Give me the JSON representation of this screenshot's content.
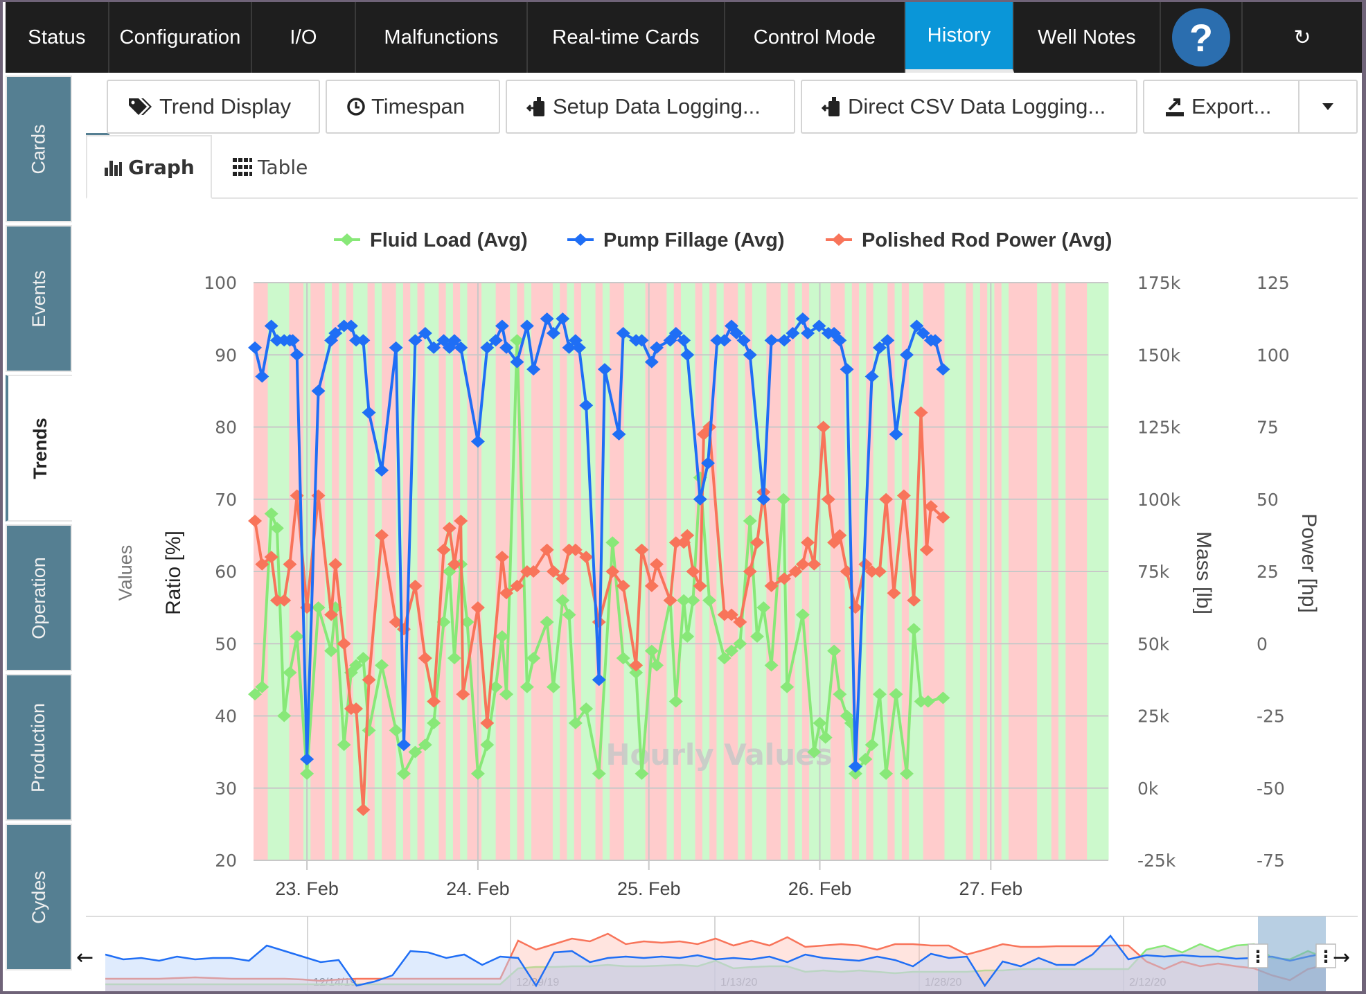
{
  "topnav": {
    "tabs": [
      {
        "label": "Status",
        "active": false
      },
      {
        "label": "Configuration",
        "active": false
      },
      {
        "label": "I/O",
        "active": false
      },
      {
        "label": "Malfunctions",
        "active": false
      },
      {
        "label": "Real-time Cards",
        "active": false
      },
      {
        "label": "Control Mode",
        "active": false
      },
      {
        "label": "History",
        "active": true
      },
      {
        "label": "Well Notes",
        "active": false
      }
    ],
    "help_label": "?",
    "refresh_label": "↻"
  },
  "sidetabs": [
    {
      "label": "Cards",
      "active": false
    },
    {
      "label": "Events",
      "active": false
    },
    {
      "label": "Trends",
      "active": true
    },
    {
      "label": "Operation",
      "active": false
    },
    {
      "label": "Production",
      "active": false
    },
    {
      "label": "Cydes",
      "active": false
    }
  ],
  "toolbar": {
    "trend_display": "Trend Display",
    "timespan": "Timespan",
    "setup_logging": "Setup Data Logging...",
    "direct_csv": "Direct CSV Data Logging...",
    "export": "Export...",
    "dropdown_icon": "caret-down-icon"
  },
  "view_tabs": {
    "graph": "Graph",
    "table": "Table",
    "active": "graph"
  },
  "colors": {
    "fluid_load": "#88e878",
    "pump_fillage": "#1f6ef5",
    "polished_rod_power": "#f8745a",
    "band_on": "#ccf9cc",
    "band_off": "#ffcccc",
    "active_tab": "#0a96d8",
    "side_tab": "#557f92"
  },
  "chart_data": {
    "type": "line",
    "watermark": "Hourly Values",
    "axis_title_group": "Values",
    "x_unit": "hours since 23 Feb 00:00",
    "xlim": [
      -7.5,
      112.5
    ],
    "x_ticks": [
      {
        "x": 0,
        "label": "23. Feb"
      },
      {
        "x": 24,
        "label": "24. Feb"
      },
      {
        "x": 48,
        "label": "25. Feb"
      },
      {
        "x": 72,
        "label": "26. Feb"
      },
      {
        "x": 96,
        "label": "27. Feb"
      }
    ],
    "y_axes": [
      {
        "title": "Ratio [%]",
        "side": "left",
        "ticks": [
          "100",
          "90",
          "80",
          "70",
          "60",
          "50",
          "40",
          "30",
          "20"
        ],
        "range": [
          20,
          100
        ]
      },
      {
        "title": "Mass [lb]",
        "side": "right",
        "ticks": [
          "175k",
          "150k",
          "125k",
          "100k",
          "75k",
          "50k",
          "25k",
          "0k",
          "-25k"
        ],
        "range": [
          -25000,
          175000
        ]
      },
      {
        "title": "Power [hp]",
        "side": "right",
        "ticks": [
          "125",
          "100",
          "75",
          "50",
          "25",
          "0",
          "-25",
          "-50",
          "-75"
        ],
        "range": [
          -75,
          125
        ]
      }
    ],
    "legend": [
      "Fluid Load (Avg)",
      "Pump Fillage (Avg)",
      "Polished Rod Power (Avg)"
    ],
    "legend_position": "top-center",
    "grid": true,
    "series": [
      {
        "name": "Pump Fillage (Avg)",
        "points": [
          [
            -7.3,
            91
          ],
          [
            -6.3,
            87
          ],
          [
            -5.0,
            94
          ],
          [
            -4.2,
            92
          ],
          [
            -3.2,
            92
          ],
          [
            -2.4,
            92
          ],
          [
            -2.0,
            92
          ],
          [
            -1.4,
            90
          ],
          [
            0,
            34
          ],
          [
            1.6,
            85
          ],
          [
            3.4,
            92
          ],
          [
            4.0,
            93
          ],
          [
            5.2,
            94
          ],
          [
            6.2,
            94
          ],
          [
            6.9,
            92
          ],
          [
            7.9,
            92
          ],
          [
            8.7,
            82
          ],
          [
            10.5,
            74
          ],
          [
            12.5,
            91
          ],
          [
            13.6,
            36
          ],
          [
            15.2,
            92
          ],
          [
            16.6,
            93
          ],
          [
            17.8,
            91
          ],
          [
            19.2,
            92
          ],
          [
            20.0,
            91
          ],
          [
            20.7,
            92
          ],
          [
            21.6,
            91
          ],
          [
            24.0,
            78
          ],
          [
            25.3,
            91
          ],
          [
            26.5,
            92
          ],
          [
            27.4,
            94
          ],
          [
            28.0,
            91
          ],
          [
            29.5,
            89
          ],
          [
            30.9,
            94
          ],
          [
            31.8,
            88
          ],
          [
            33.7,
            95
          ],
          [
            34.6,
            93
          ],
          [
            35.9,
            95
          ],
          [
            36.8,
            91
          ],
          [
            37.7,
            92
          ],
          [
            38.2,
            91
          ],
          [
            39.2,
            83
          ],
          [
            41.0,
            45
          ],
          [
            41.8,
            88
          ],
          [
            43.8,
            79
          ],
          [
            44.4,
            93
          ],
          [
            46.2,
            92
          ],
          [
            47.0,
            92
          ],
          [
            48.4,
            89
          ],
          [
            49.1,
            91
          ],
          [
            51.0,
            92
          ],
          [
            51.8,
            93
          ],
          [
            52.9,
            92
          ],
          [
            53.4,
            90
          ],
          [
            55.2,
            70
          ],
          [
            56.3,
            75
          ],
          [
            57.6,
            92
          ],
          [
            58.6,
            92
          ],
          [
            59.6,
            94
          ],
          [
            60.3,
            93
          ],
          [
            61.3,
            92
          ],
          [
            62.2,
            90
          ],
          [
            64.1,
            70
          ],
          [
            65.2,
            92
          ],
          [
            67.0,
            92
          ],
          [
            68.2,
            93
          ],
          [
            69.6,
            95
          ],
          [
            70.3,
            93
          ],
          [
            71.9,
            94
          ],
          [
            73.2,
            93
          ],
          [
            74.0,
            93
          ],
          [
            74.8,
            92
          ],
          [
            75.8,
            88
          ],
          [
            77.0,
            33
          ],
          [
            79.3,
            87
          ],
          [
            80.4,
            91
          ],
          [
            81.5,
            92
          ],
          [
            82.7,
            79
          ],
          [
            84.2,
            90
          ],
          [
            85.6,
            94
          ],
          [
            86.5,
            93
          ],
          [
            87.6,
            92
          ],
          [
            88.2,
            92
          ],
          [
            89.3,
            88
          ]
        ]
      },
      {
        "name": "Polished Rod Power (Avg)",
        "points": [
          [
            -7.3,
            67
          ],
          [
            -6.3,
            61
          ],
          [
            -5.0,
            62
          ],
          [
            -4.2,
            56
          ],
          [
            -3.2,
            56
          ],
          [
            -2.4,
            61
          ],
          [
            -1.4,
            70.5
          ],
          [
            0,
            55
          ],
          [
            1.6,
            70.5
          ],
          [
            3.4,
            54
          ],
          [
            4.0,
            61
          ],
          [
            5.2,
            50
          ],
          [
            6.2,
            41
          ],
          [
            6.9,
            41
          ],
          [
            7.9,
            27
          ],
          [
            8.7,
            45
          ],
          [
            10.5,
            65
          ],
          [
            12.5,
            53
          ],
          [
            13.6,
            52
          ],
          [
            15.2,
            58
          ],
          [
            16.6,
            48
          ],
          [
            17.8,
            42
          ],
          [
            19.2,
            63
          ],
          [
            20.0,
            66
          ],
          [
            20.7,
            61
          ],
          [
            21.6,
            67
          ],
          [
            21.9,
            43
          ],
          [
            24.0,
            55
          ],
          [
            25.3,
            39
          ],
          [
            27.4,
            62
          ],
          [
            28.0,
            57
          ],
          [
            29.5,
            58
          ],
          [
            30.9,
            60
          ],
          [
            31.8,
            60
          ],
          [
            33.7,
            63
          ],
          [
            34.6,
            60
          ],
          [
            35.9,
            59
          ],
          [
            36.8,
            63
          ],
          [
            37.7,
            63
          ],
          [
            39.2,
            62
          ],
          [
            41.0,
            53
          ],
          [
            42.9,
            60
          ],
          [
            44.4,
            58
          ],
          [
            46.2,
            47
          ],
          [
            47.0,
            63
          ],
          [
            48.4,
            58
          ],
          [
            49.1,
            61
          ],
          [
            51.0,
            56
          ],
          [
            51.8,
            64
          ],
          [
            52.9,
            64
          ],
          [
            53.4,
            65
          ],
          [
            54.2,
            60
          ],
          [
            55.2,
            58
          ],
          [
            55.7,
            79
          ],
          [
            56.5,
            80
          ],
          [
            58.6,
            54
          ],
          [
            59.6,
            54
          ],
          [
            60.8,
            53
          ],
          [
            62.2,
            60
          ],
          [
            63.2,
            64
          ],
          [
            64.1,
            71
          ],
          [
            65.2,
            58
          ],
          [
            67.0,
            59
          ],
          [
            68.6,
            60
          ],
          [
            69.6,
            61
          ],
          [
            70.3,
            64
          ],
          [
            71.2,
            61
          ],
          [
            72.5,
            80
          ],
          [
            73.2,
            70
          ],
          [
            74.0,
            64
          ],
          [
            74.8,
            65
          ],
          [
            75.8,
            60
          ],
          [
            77.0,
            55
          ],
          [
            78.4,
            61
          ],
          [
            79.3,
            60
          ],
          [
            80.4,
            60
          ],
          [
            81.3,
            70
          ],
          [
            82.4,
            57
          ],
          [
            83.8,
            70.5
          ],
          [
            85.2,
            56
          ],
          [
            86.2,
            82
          ],
          [
            87.0,
            63
          ],
          [
            87.6,
            69
          ],
          [
            89.3,
            67.5
          ]
        ]
      },
      {
        "name": "Fluid Load (Avg)",
        "points": [
          [
            -7.3,
            43
          ],
          [
            -6.3,
            44
          ],
          [
            -5.0,
            68
          ],
          [
            -4.2,
            66
          ],
          [
            -3.2,
            40
          ],
          [
            -2.4,
            46
          ],
          [
            -1.4,
            51
          ],
          [
            0,
            32
          ],
          [
            1.6,
            55
          ],
          [
            3.4,
            49
          ],
          [
            4.0,
            55
          ],
          [
            5.2,
            36
          ],
          [
            6.2,
            46
          ],
          [
            6.9,
            47
          ],
          [
            7.9,
            48
          ],
          [
            8.7,
            38
          ],
          [
            10.5,
            47
          ],
          [
            12.5,
            38
          ],
          [
            13.6,
            32
          ],
          [
            15.2,
            35
          ],
          [
            16.6,
            36
          ],
          [
            17.8,
            39
          ],
          [
            19.2,
            53
          ],
          [
            20.0,
            60
          ],
          [
            20.7,
            48
          ],
          [
            21.6,
            61
          ],
          [
            22.5,
            53
          ],
          [
            24.0,
            32
          ],
          [
            25.3,
            36
          ],
          [
            26.5,
            44
          ],
          [
            27.4,
            51
          ],
          [
            28.0,
            43
          ],
          [
            29.5,
            92
          ],
          [
            30.9,
            44
          ],
          [
            31.8,
            48
          ],
          [
            33.7,
            53
          ],
          [
            34.6,
            44
          ],
          [
            35.9,
            56
          ],
          [
            36.8,
            54
          ],
          [
            37.7,
            39
          ],
          [
            39.2,
            41
          ],
          [
            41.0,
            32
          ],
          [
            42.9,
            64
          ],
          [
            44.4,
            48
          ],
          [
            46.2,
            46
          ],
          [
            47.0,
            32
          ],
          [
            48.4,
            49
          ],
          [
            49.1,
            47
          ],
          [
            51.0,
            56
          ],
          [
            51.8,
            42
          ],
          [
            52.9,
            56
          ],
          [
            53.4,
            51
          ],
          [
            54.2,
            56
          ],
          [
            55.2,
            73
          ],
          [
            56.5,
            56
          ],
          [
            58.6,
            48
          ],
          [
            59.6,
            49
          ],
          [
            60.8,
            50
          ],
          [
            62.2,
            67
          ],
          [
            63.2,
            51
          ],
          [
            64.1,
            55
          ],
          [
            65.2,
            47
          ],
          [
            66.9,
            70
          ],
          [
            67.4,
            44
          ],
          [
            69.6,
            54
          ],
          [
            71.2,
            35
          ],
          [
            72.0,
            39
          ],
          [
            72.8,
            37
          ],
          [
            74.0,
            49
          ],
          [
            74.8,
            43
          ],
          [
            75.8,
            40
          ],
          [
            76.4,
            39
          ],
          [
            77.0,
            32
          ],
          [
            78.4,
            34
          ],
          [
            79.3,
            36
          ],
          [
            80.4,
            43
          ],
          [
            81.3,
            32
          ],
          [
            82.7,
            43
          ],
          [
            84.2,
            32
          ],
          [
            85.2,
            52
          ],
          [
            86.2,
            42
          ],
          [
            87.2,
            42
          ],
          [
            89.3,
            42.5
          ]
        ]
      }
    ],
    "bands": {
      "pattern": "alternating green (running) / red (stopped) hourly shading across the plot",
      "colors": [
        "#ccf9cc",
        "#ffcccc"
      ]
    }
  },
  "navigator": {
    "date_labels": [
      "12/14/19",
      "12/29/19",
      "1/13/20",
      "1/28/20",
      "2/12/20"
    ],
    "selection_handles": [
      "⋮",
      "⋮"
    ],
    "left_arrow": "←",
    "right_arrow": "→"
  }
}
